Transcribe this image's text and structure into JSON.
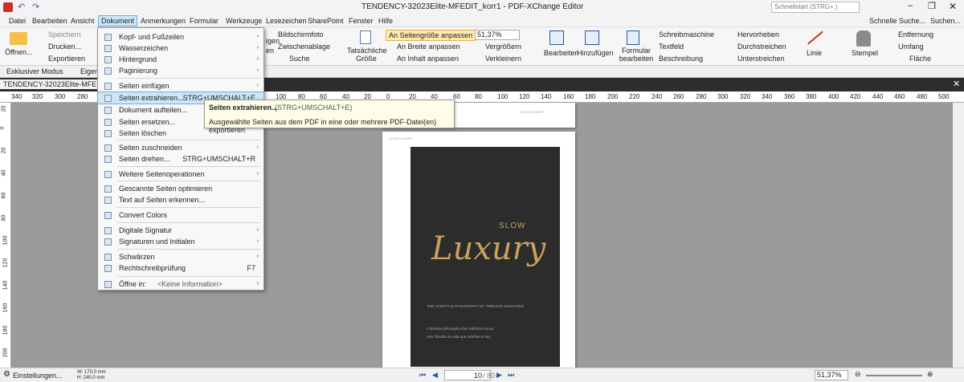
{
  "window": {
    "title": "TENDENCY-32023Elite-MFEDIT_korr1 - PDF-XChange Editor",
    "search_placeholder": "Schnellstart (STRG+.)"
  },
  "menu": [
    "Datei",
    "Bearbeiten",
    "Ansicht",
    "Dokument",
    "Anmerkungen",
    "Formular",
    "Werkzeuge",
    "Lesezeichen",
    "SharePoint",
    "Fenster",
    "Hilfe"
  ],
  "menu_right": {
    "quick_search": "Schnelle Suche...",
    "search": "Suchen..."
  },
  "ribbon": {
    "open": "Öffnen...",
    "save": "Speichern",
    "print": "Drucken...",
    "export": "Exportieren",
    "snapshot": "Bildschirmfoto",
    "clipboard": "Zwischenablage",
    "search": "Suche",
    "actual_size": "Tatsächliche Größe",
    "fit_page": "An Seitengröße anpassen",
    "fit_width": "An Breite anpassen",
    "fit_content": "An Inhalt anpassen",
    "zoom": "51,37%",
    "zoom_in": "Vergrößern",
    "zoom_out": "Verkleinern",
    "edit": "Bearbeiten",
    "add": "Hinzufügen",
    "form_edit": "Formular bearbeiten",
    "typewriter": "Schreibmaschine",
    "textfield": "Textfeld",
    "note": "Beschreibung",
    "highlight": "Hervorheben",
    "strikeout": "Durchstreichen",
    "underline": "Unterstreichen",
    "line": "Linie",
    "stamp": "Stempel",
    "erase": "Entfernung",
    "perimeter": "Umfang",
    "area": "Fläche",
    "partial_left": "igen",
    "partial_left2": "en"
  },
  "modebar": {
    "exclusive": "Exklusiver Modus",
    "props": "Eigen"
  },
  "tab": {
    "label": "TENDENCY-32023Elite-MFEDIT..."
  },
  "ruler": {
    "h": [
      "340",
      "320",
      "300",
      "280",
      "100",
      "80",
      "60",
      "40",
      "20",
      "0",
      "20",
      "40",
      "60",
      "80",
      "100",
      "120",
      "140",
      "160",
      "180",
      "200",
      "220",
      "240",
      "260",
      "280",
      "300",
      "320",
      "340",
      "360",
      "380",
      "400",
      "420",
      "440",
      "460",
      "480",
      "500"
    ],
    "v": [
      "20",
      "0",
      "20",
      "40",
      "60",
      "80",
      "100",
      "120",
      "140",
      "160",
      "180",
      "200"
    ]
  },
  "dropdown": {
    "items": [
      {
        "label": "Kopf- und Fußzeilen",
        "arrow": "›"
      },
      {
        "label": "Wasserzeichen",
        "arrow": "›"
      },
      {
        "label": "Hintergrund",
        "arrow": "›"
      },
      {
        "label": "Paginierung",
        "arrow": "›"
      },
      {
        "label": "Seiten einfügen",
        "arrow": "›"
      },
      {
        "label": "Seiten extrahieren...",
        "shortcut": "STRG+UMSCHALT+E"
      },
      {
        "label": "Dokument aufteilen..."
      },
      {
        "label": "Seiten ersetzen..."
      },
      {
        "label": "Seiten löschen"
      },
      {
        "label": "Seiten zuschneiden",
        "arrow": "›"
      },
      {
        "label": "Seiten drehen...",
        "shortcut": "STRG+UMSCHALT+R"
      },
      {
        "label": "Weitere Seitenoperationen",
        "arrow": "›"
      },
      {
        "label": "Gescannte Seiten optimieren"
      },
      {
        "label": "Text auf Seiten erkennen..."
      },
      {
        "label": "Convert Colors"
      },
      {
        "label": "Digitale Signatur",
        "arrow": "›"
      },
      {
        "label": "Signaturen und Initialen",
        "arrow": "›"
      },
      {
        "label": "Schwärzen",
        "arrow": "›"
      },
      {
        "label": "Rechtschreibprüfung",
        "shortcut": "F7"
      },
      {
        "label": "Öffne in:",
        "extra": "<Keine Information>",
        "arrow": "›"
      }
    ]
  },
  "tooltip": {
    "title": "Seiten extrahieren...",
    "shortcut": "(STRG+UMSCHALT+E)",
    "desc": "Ausgewählte Seiten aus dem PDF in eine oder mehrere PDF-Datei(en) exportieren"
  },
  "page": {
    "header_small": "SLOW LUXURY",
    "cover_slow": "SLOW",
    "cover_luxury": "Luxury",
    "cover_sub": "THE LIFESTYLE PHILOSOPHY OF TIMELESS ELEGANCE",
    "cover_l1": "A lifestyle philosophy that redefines luxury",
    "cover_l2": "Une filosofia de vida que redefine el lujo"
  },
  "status": {
    "settings": "Einstellungen...",
    "w": "W: 170,0 mm",
    "h": "H: 240,0 mm",
    "page_current": "10",
    "page_total": "/ 80",
    "zoom": "51,37%"
  },
  "colors": {
    "accent": "#2a579a",
    "menu_hl": "#cde6f7",
    "gold": "#c8a25a",
    "dark": "#2b2c2b"
  }
}
